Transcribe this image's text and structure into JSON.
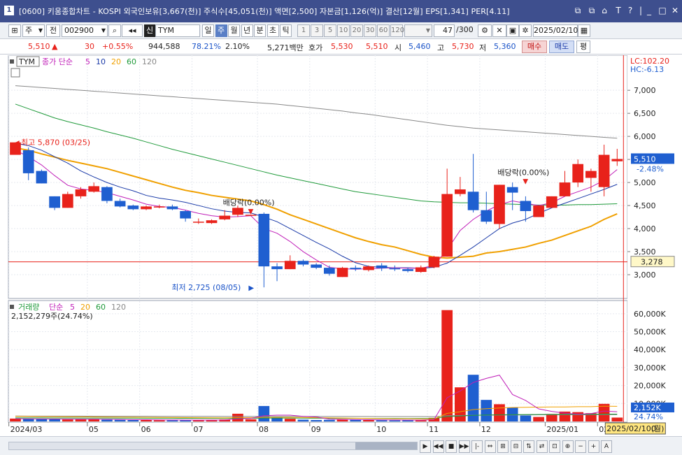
{
  "window": {
    "badge": "1",
    "title": "[0600] 키움종합차트 - KOSPI 외국인보유[3,667(천)] 주식수[45,051(천)] 액면[2,500] 자본금[1,126(억)] 결산[12월] EPS[1,341] PER[4.11]",
    "controls": [
      "⧉",
      "⧉",
      "⌂",
      "T",
      "?",
      "|",
      "_",
      "□",
      "✕"
    ]
  },
  "toolbar": {
    "period_unit": "주",
    "prev_label": "전",
    "code": "002900",
    "market_label": "신",
    "name": "TYM",
    "periods": [
      "일",
      "주",
      "월",
      "년",
      "분",
      "초",
      "틱"
    ],
    "selected_period": "주",
    "intervals": [
      "1",
      "3",
      "5",
      "10",
      "20",
      "30",
      "60",
      "120"
    ],
    "count": "47",
    "count_total": "/300",
    "date": "2025/02/10"
  },
  "quote": {
    "price": "5,510",
    "change_arrow": "▲",
    "change": "30",
    "change_rate": "+0.55%",
    "volume": "944,588",
    "vol_ratio": "78.21%",
    "turnover": "2.10%",
    "amount": "5,271백만",
    "hoga_label": "호가",
    "ask": "5,530",
    "bid": "5,510",
    "open_label": "시",
    "open": "5,460",
    "high_label": "고",
    "high": "5,730",
    "low_label": "저",
    "low": "5,360",
    "buy_label": "매수",
    "sell_label": "매도",
    "avg_label": "평"
  },
  "footer": {
    "buttons": [
      "▶",
      "◀◀",
      "■",
      "▶▶",
      "|-",
      "⇔",
      "⊞",
      "⊟",
      "⇅",
      "⇄",
      "⊡",
      "⊕",
      "−",
      "+",
      "A"
    ]
  },
  "chart_data": [
    {
      "type": "candlestick",
      "legend": {
        "stock": "TYM",
        "ma_label": "종가 단순",
        "ma_periods": [
          {
            "name": "5",
            "color": "#c01fb8"
          },
          {
            "name": "10",
            "color": "#1a3aa8"
          },
          {
            "name": "20",
            "color": "#f0a000"
          },
          {
            "name": "60",
            "color": "#1f9a3a"
          },
          {
            "name": "120",
            "color": "#888888"
          }
        ]
      },
      "ylim": [
        2500,
        7700
      ],
      "y_ticks": [
        3000,
        3500,
        4000,
        4500,
        5000,
        5500,
        6000,
        6500,
        7000
      ],
      "y_tick_labels": [
        "3,000",
        "3,500",
        "4,000",
        "4,500",
        "5,000",
        "5,500",
        "6,000",
        "6,500",
        "7,000"
      ],
      "lc_label": "LC:102.20",
      "hc_label": "HC:-6.13",
      "current_price_label": "5,510",
      "current_change_label": "-2.48%",
      "ref_line_value": 3278,
      "ref_line_label": "3,278",
      "x_labels": [
        {
          "i": 0,
          "label": "2024/03"
        },
        {
          "i": 6,
          "label": "05"
        },
        {
          "i": 10,
          "label": "06"
        },
        {
          "i": 14,
          "label": "07"
        },
        {
          "i": 19,
          "label": "08"
        },
        {
          "i": 23,
          "label": "09"
        },
        {
          "i": 28,
          "label": "10"
        },
        {
          "i": 32,
          "label": "11"
        },
        {
          "i": 36,
          "label": "12"
        },
        {
          "i": 41,
          "label": "2025/01"
        },
        {
          "i": 45,
          "label": "02"
        }
      ],
      "candles": [
        {
          "o": 5600,
          "h": 5870,
          "l": 5600,
          "c": 5870
        },
        {
          "o": 5700,
          "h": 5760,
          "l": 5050,
          "c": 5200
        },
        {
          "o": 5250,
          "h": 5280,
          "l": 4980,
          "c": 4980
        },
        {
          "o": 4700,
          "h": 4700,
          "l": 4400,
          "c": 4450
        },
        {
          "o": 4450,
          "h": 4800,
          "l": 4450,
          "c": 4750
        },
        {
          "o": 4700,
          "h": 4900,
          "l": 4650,
          "c": 4850
        },
        {
          "o": 4800,
          "h": 5000,
          "l": 4780,
          "c": 4920
        },
        {
          "o": 4900,
          "h": 4920,
          "l": 4550,
          "c": 4600
        },
        {
          "o": 4600,
          "h": 4650,
          "l": 4460,
          "c": 4480
        },
        {
          "o": 4500,
          "h": 4520,
          "l": 4400,
          "c": 4420
        },
        {
          "o": 4420,
          "h": 4500,
          "l": 4400,
          "c": 4480
        },
        {
          "o": 4480,
          "h": 4520,
          "l": 4440,
          "c": 4480
        },
        {
          "o": 4480,
          "h": 4520,
          "l": 4400,
          "c": 4420
        },
        {
          "o": 4380,
          "h": 4400,
          "l": 4150,
          "c": 4220
        },
        {
          "o": 4150,
          "h": 4220,
          "l": 4100,
          "c": 4150
        },
        {
          "o": 4120,
          "h": 4200,
          "l": 4100,
          "c": 4180
        },
        {
          "o": 4200,
          "h": 4400,
          "l": 4180,
          "c": 4280
        },
        {
          "o": 4300,
          "h": 4500,
          "l": 4250,
          "c": 4450
        },
        {
          "o": 4300,
          "h": 4300,
          "l": 4300,
          "c": 4300
        },
        {
          "o": 4320,
          "h": 4350,
          "l": 2725,
          "c": 3180
        },
        {
          "o": 3180,
          "h": 3250,
          "l": 2860,
          "c": 3120
        },
        {
          "o": 3120,
          "h": 3420,
          "l": 3120,
          "c": 3300
        },
        {
          "o": 3300,
          "h": 3330,
          "l": 3180,
          "c": 3220
        },
        {
          "o": 3220,
          "h": 3250,
          "l": 3120,
          "c": 3150
        },
        {
          "o": 3150,
          "h": 3200,
          "l": 2980,
          "c": 3020
        },
        {
          "o": 2950,
          "h": 3170,
          "l": 2950,
          "c": 3150
        },
        {
          "o": 3150,
          "h": 3200,
          "l": 3080,
          "c": 3120
        },
        {
          "o": 3100,
          "h": 3200,
          "l": 3070,
          "c": 3180
        },
        {
          "o": 3200,
          "h": 3250,
          "l": 3080,
          "c": 3140
        },
        {
          "o": 3140,
          "h": 3200,
          "l": 3080,
          "c": 3120
        },
        {
          "o": 3120,
          "h": 3150,
          "l": 3050,
          "c": 3080
        },
        {
          "o": 3060,
          "h": 3200,
          "l": 3040,
          "c": 3160
        },
        {
          "o": 3160,
          "h": 3410,
          "l": 3140,
          "c": 3390
        },
        {
          "o": 3390,
          "h": 5300,
          "l": 3390,
          "c": 4750
        },
        {
          "o": 4750,
          "h": 5120,
          "l": 4700,
          "c": 4850
        },
        {
          "o": 4800,
          "h": 5620,
          "l": 4350,
          "c": 4400
        },
        {
          "o": 4400,
          "h": 4800,
          "l": 4100,
          "c": 4150
        },
        {
          "o": 4100,
          "h": 4950,
          "l": 4000,
          "c": 4950
        },
        {
          "o": 4900,
          "h": 5000,
          "l": 4400,
          "c": 4780
        },
        {
          "o": 4600,
          "h": 4700,
          "l": 4150,
          "c": 4380
        },
        {
          "o": 4250,
          "h": 4500,
          "l": 4250,
          "c": 4500
        },
        {
          "o": 4450,
          "h": 4700,
          "l": 4450,
          "c": 4700
        },
        {
          "o": 4700,
          "h": 5250,
          "l": 4700,
          "c": 5000
        },
        {
          "o": 5000,
          "h": 5500,
          "l": 4900,
          "c": 5400
        },
        {
          "o": 5100,
          "h": 5300,
          "l": 4800,
          "c": 5250
        },
        {
          "o": 4900,
          "h": 5820,
          "l": 4700,
          "c": 5600
        },
        {
          "o": 5460,
          "h": 5730,
          "l": 5360,
          "c": 5510
        }
      ],
      "ma": {
        "5": [
          5700,
          5560,
          5380,
          5150,
          4940,
          4860,
          4830,
          4780,
          4700,
          4620,
          4530,
          4480,
          4460,
          4400,
          4330,
          4280,
          4250,
          4260,
          4280,
          4000,
          3900,
          3720,
          3500,
          3320,
          3160,
          3130,
          3120,
          3130,
          3140,
          3150,
          3140,
          3140,
          3200,
          3540,
          3960,
          4200,
          4380,
          4520,
          4600,
          4550,
          4500,
          4560,
          4700,
          4800,
          4900,
          5050,
          5280
        ],
        "10": [
          5850,
          5800,
          5700,
          5560,
          5420,
          5250,
          5120,
          5000,
          4900,
          4820,
          4720,
          4660,
          4620,
          4570,
          4500,
          4430,
          4380,
          4350,
          4340,
          4250,
          4150,
          4000,
          3850,
          3700,
          3560,
          3400,
          3260,
          3180,
          3160,
          3150,
          3150,
          3140,
          3160,
          3250,
          3420,
          3600,
          3800,
          4000,
          4120,
          4200,
          4330,
          4450,
          4550,
          4650,
          4750,
          4850,
          4960
        ],
        "20": [
          5750,
          5700,
          5620,
          5550,
          5480,
          5420,
          5360,
          5300,
          5220,
          5140,
          5060,
          4980,
          4900,
          4830,
          4780,
          4720,
          4680,
          4640,
          4600,
          4520,
          4420,
          4300,
          4200,
          4100,
          4000,
          3900,
          3800,
          3720,
          3650,
          3600,
          3520,
          3440,
          3380,
          3360,
          3380,
          3400,
          3470,
          3500,
          3550,
          3600,
          3680,
          3750,
          3850,
          3950,
          4050,
          4200,
          4320
        ],
        "60": [
          6700,
          6600,
          6500,
          6400,
          6320,
          6250,
          6180,
          6100,
          6030,
          5960,
          5880,
          5800,
          5720,
          5650,
          5580,
          5510,
          5440,
          5370,
          5300,
          5230,
          5160,
          5100,
          5040,
          4980,
          4920,
          4860,
          4800,
          4760,
          4720,
          4680,
          4640,
          4600,
          4580,
          4570,
          4560,
          4560,
          4550,
          4540,
          4530,
          4520,
          4510,
          4510,
          4510,
          4520,
          4520,
          4530,
          4540
        ],
        "120": [
          7100,
          7080,
          7060,
          7040,
          7020,
          7000,
          6980,
          6960,
          6940,
          6920,
          6900,
          6880,
          6860,
          6840,
          6820,
          6800,
          6780,
          6760,
          6740,
          6720,
          6700,
          6670,
          6640,
          6610,
          6580,
          6550,
          6510,
          6480,
          6440,
          6400,
          6360,
          6320,
          6280,
          6240,
          6210,
          6180,
          6160,
          6140,
          6120,
          6100,
          6080,
          6060,
          6040,
          6020,
          6000,
          5980,
          5960
        ]
      },
      "annotations": [
        {
          "text": "최고 5,870 (03/25)",
          "i": 0,
          "value": 5870,
          "color": "#e8221b"
        },
        {
          "text": "최저 2,725 (08/05)",
          "i": 19,
          "value": 2725,
          "color": "#1a53c8"
        },
        {
          "text": "배당락(0.00%)",
          "i": 18,
          "value": 4300,
          "color": "#222222"
        },
        {
          "text": "배당락(0.00%)",
          "i": 39,
          "value": 4950,
          "color": "#222222"
        }
      ]
    },
    {
      "type": "bar",
      "legend": {
        "name": "거래량",
        "ma_label": "단순",
        "ma_periods": [
          {
            "name": "5",
            "color": "#c01fb8"
          },
          {
            "name": "20",
            "color": "#f0a000"
          },
          {
            "name": "60",
            "color": "#1f9a3a"
          },
          {
            "name": "120",
            "color": "#888888"
          }
        ]
      },
      "current_volume_label": "2,152,279주(24.74%)",
      "ylim": [
        0,
        65000
      ],
      "y_ticks": [
        10000,
        20000,
        30000,
        40000,
        50000,
        60000
      ],
      "y_tick_labels": [
        "10,000K",
        "20,000K",
        "30,000K",
        "40,000K",
        "50,000K",
        "60,000K"
      ],
      "current_value_label": "2,152K",
      "current_ratio_label": "24.74%",
      "volumes": [
        1600,
        1400,
        1300,
        1200,
        1100,
        1200,
        1400,
        1000,
        900,
        800,
        800,
        700,
        700,
        900,
        700,
        800,
        1100,
        4300,
        1200,
        8600,
        2400,
        1500,
        1000,
        800,
        900,
        1200,
        1100,
        800,
        700,
        600,
        800,
        700,
        2000,
        62000,
        19000,
        26000,
        12000,
        9600,
        7800,
        3300,
        2500,
        4200,
        5500,
        5200,
        4600,
        9800,
        2152
      ],
      "ma": {
        "5": [
          1500,
          1450,
          1400,
          1350,
          1300,
          1250,
          1250,
          1200,
          1100,
          1000,
          950,
          900,
          850,
          800,
          800,
          800,
          850,
          1500,
          1700,
          3200,
          3500,
          3500,
          2800,
          2500,
          1300,
          1100,
          1000,
          950,
          900,
          850,
          800,
          750,
          1000,
          13200,
          17000,
          21700,
          24000,
          25800,
          15000,
          11700,
          7000,
          5600,
          4600,
          4100,
          4400,
          5800,
          5400
        ],
        "20": [
          2800,
          2750,
          2700,
          2650,
          2600,
          2550,
          2500,
          2450,
          2400,
          2350,
          2300,
          2250,
          2200,
          2150,
          2100,
          2050,
          2000,
          2100,
          2100,
          2300,
          2300,
          2300,
          2200,
          2100,
          2000,
          1900,
          1800,
          1700,
          1600,
          1500,
          1500,
          1400,
          1400,
          4500,
          5400,
          6600,
          7100,
          7500,
          7800,
          7900,
          8000,
          8100,
          8100,
          8200,
          8200,
          8500,
          8400
        ],
        "60": [
          2000,
          2000,
          1980,
          1960,
          1940,
          1920,
          1900,
          1880,
          1860,
          1840,
          1820,
          1800,
          1780,
          1760,
          1740,
          1720,
          1700,
          1750,
          1750,
          1900,
          1900,
          1900,
          1850,
          1800,
          1780,
          1760,
          1740,
          1720,
          1700,
          1680,
          1660,
          1640,
          1650,
          2700,
          3000,
          3400,
          3600,
          3700,
          3800,
          3850,
          3880,
          3900,
          3950,
          3980,
          4000,
          4100,
          4100
        ],
        "120": [
          3000,
          2990,
          2980,
          2970,
          2960,
          2950,
          2940,
          2930,
          2920,
          2910,
          2900,
          2890,
          2880,
          2870,
          2860,
          2850,
          2840,
          2830,
          2820,
          2830,
          2820,
          2810,
          2800,
          2790,
          2780,
          2770,
          2760,
          2750,
          2740,
          2730,
          2720,
          2710,
          2700,
          3200,
          3300,
          3450,
          3520,
          3580,
          3620,
          3650,
          3680,
          3700,
          3720,
          3740,
          3760,
          3800,
          3800
        ]
      },
      "cursor_date_label": "2025/02/10(월)",
      "cursor_value_label": "0"
    }
  ]
}
